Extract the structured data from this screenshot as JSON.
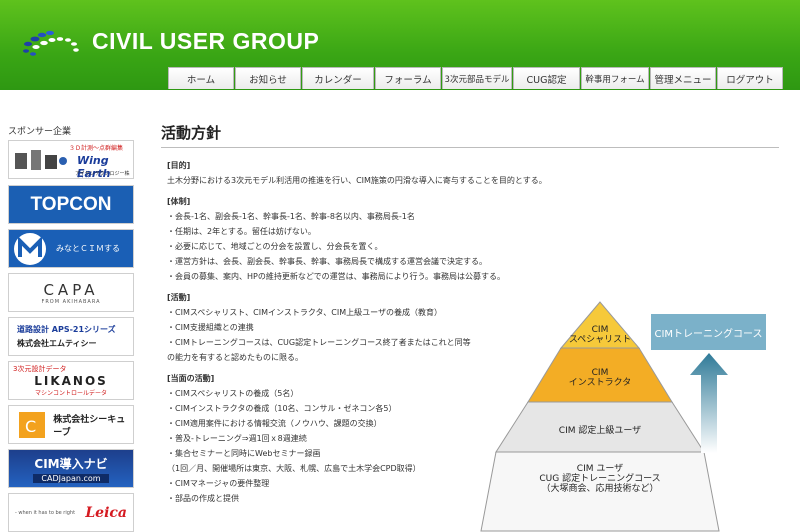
{
  "site": {
    "title": "CIVIL USER GROUP"
  },
  "nav": [
    "ホーム",
    "お知らせ",
    "カレンダー",
    "フォーラム",
    "3次元部品モデル",
    "CUG認定",
    "幹事用フォーム",
    "管理メニュー",
    "ログアウト"
  ],
  "sidebar": {
    "title": "スポンサー企業",
    "sponsors": [
      {
        "line1": "３Ｄ計測～点群編集",
        "name": "Wing Earth",
        "line3": "アイサンテクノロジー株式会社"
      },
      {
        "name": "TOPCON"
      },
      {
        "name": "みなとＣＩＭする"
      },
      {
        "name": "CAPA",
        "sub": "FROM AKIHABARA"
      },
      {
        "line1": "道路設計 APS-21シリーズ",
        "name": "株式会社エムティシー"
      },
      {
        "line1": "3次元設計データ",
        "name": "LIKANOS",
        "line3": "マシンコントロールデータ"
      },
      {
        "name": "株式会社シーキューブ"
      },
      {
        "name": "CIM導入ナビ",
        "sub": "CADJapan.com"
      },
      {
        "sub": "- when it has to be right",
        "name": "Leica"
      }
    ]
  },
  "main": {
    "title": "活動方針",
    "sections": [
      {
        "heading": "[目的]",
        "lines": [
          "土木分野における3次元モデル利活用の推進を行い、CIM施策の円滑な導入に寄与することを目的とする。"
        ]
      },
      {
        "heading": "[体制]",
        "lines": [
          "・会長-1名、副会長-1名、幹事長-1名、幹事-8名以内、事務局長-1名",
          "・任期は、2年とする。留任は妨げない。",
          "・必要に応じて、地域ごとの分会を設置し、分会長を置く。",
          "・運営方針は、会長、副会長、幹事長、幹事、事務局長で構成する運営会議で決定する。",
          "・会員の募集、案内、HPの維持更新などでの運営は、事務局により行う。事務局は公募する。"
        ]
      },
      {
        "heading": "[活動]",
        "lines": [
          "・CIMスペシャリスト、CIMインストラクタ、CIM上級ユーザの養成（教育）",
          "・CIM支援組織との連携",
          "・CIMトレーニングコースは、CUG認定トレーニングコース終了者またはこれと同等",
          "の能力を有すると認めたものに限る。"
        ]
      },
      {
        "heading": "[当面の活動]",
        "lines": [
          "・CIMスペシャリストの養成（5名）",
          "・CIMインストラクタの養成（10名、コンサル・ゼネコン各5）",
          "・CIM適用案件における情報交流（ノウハウ、課題の交換）",
          "・普及-トレーニング⇒週1回ｘ8週連続",
          "・集合セミナーと同時にWebセミナー録画",
          "（1回／月、開催場所は東京、大阪、札幌、広島で土木学会CPD取得）",
          "・CIMマネージャの要件整理",
          "・部品の作成と提供"
        ]
      }
    ]
  },
  "pyramid": {
    "tier1": [
      "CIM",
      "スペシャリスト"
    ],
    "tier2": [
      "CIM",
      "インストラクタ"
    ],
    "tier3": [
      "CIM 認定上級ユーザ"
    ],
    "tier4": [
      "CIM ユーザ",
      "CUG 認定トレーニングコース",
      "（大塚商会、応用技術など）"
    ],
    "training_box": "CIMトレーニングコース",
    "colors": {
      "top": "#f6c93a",
      "mid": "#f3ad25",
      "low": "#e6e6e6",
      "base": "#f7f7f7",
      "box": "#7bb1c9",
      "arrow": "#2f7a98"
    }
  }
}
